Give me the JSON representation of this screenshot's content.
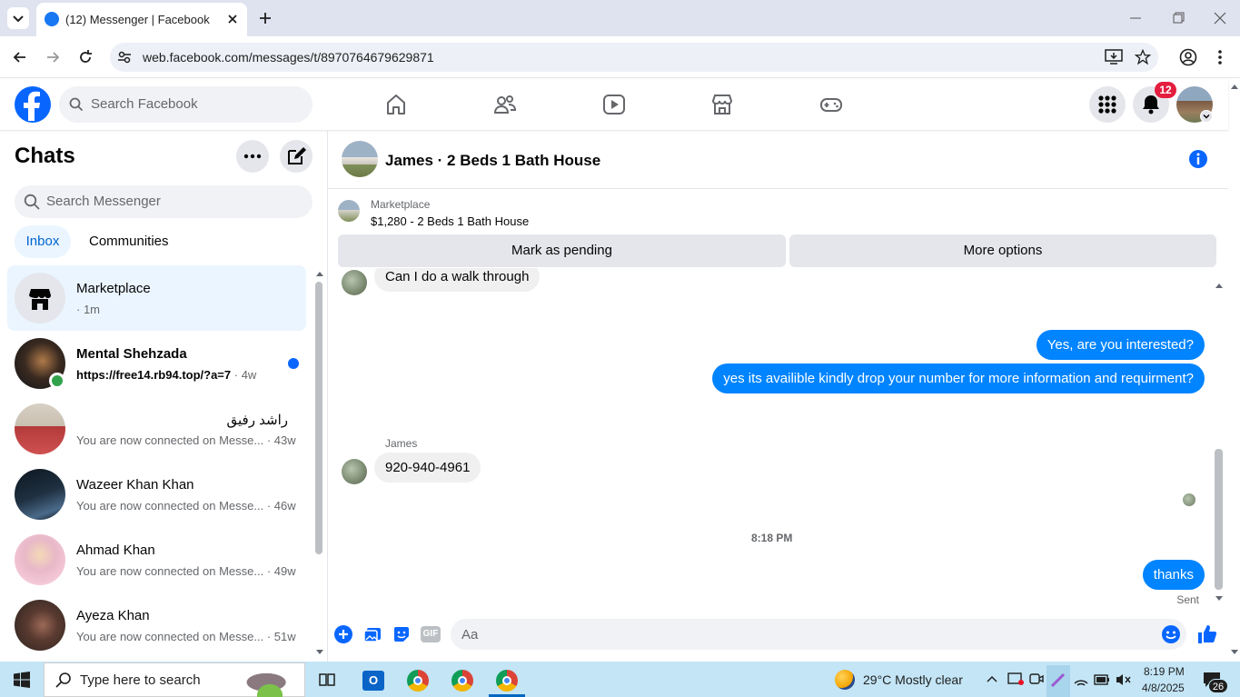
{
  "browser": {
    "tab_title": "(12) Messenger | Facebook",
    "url": "web.facebook.com/messages/t/8970764679629871"
  },
  "fb": {
    "search_placeholder": "Search Facebook",
    "notification_count": "12"
  },
  "sidebar": {
    "title": "Chats",
    "search_placeholder": "Search Messenger",
    "tabs": [
      "Inbox",
      "Communities"
    ],
    "chats": [
      {
        "name": "Marketplace",
        "sub": "· 1m"
      },
      {
        "name": "Mental Shehzada",
        "sub": "https://free14.rb94.top/?a=7",
        "time": " · 4w"
      },
      {
        "name": "راشد رفیق",
        "sub": "You are now connected on Messe... · 43w"
      },
      {
        "name": "Wazeer Khan Khan",
        "sub": "You are now connected on Messe... · 46w"
      },
      {
        "name": "Ahmad Khan",
        "sub": "You are now connected on Messe... · 49w"
      },
      {
        "name": "Ayeza Khan",
        "sub": "You are now connected on Messe... · 51w"
      }
    ]
  },
  "conversation": {
    "title": "James · 2 Beds 1 Bath House",
    "marketplace_label": "Marketplace",
    "listing": "$1,280 - 2 Beds 1 Bath House",
    "btn_pending": "Mark as pending",
    "btn_more": "More options",
    "messages": {
      "partial": "Can I do a walk through",
      "out1": "Yes, are you interested?",
      "out2": "yes its availible kindly drop your number for more information and requirment?",
      "sender": "James",
      "in1": "920-940-4961",
      "timestamp": "8:18 PM",
      "out3": "thanks",
      "status": "Sent"
    },
    "composer_placeholder": "Aa"
  },
  "taskbar": {
    "search_placeholder": "Type here to search",
    "weather": "29°C  Mostly clear",
    "time": "8:19 PM",
    "date": "4/8/2025",
    "notif_count": "26"
  }
}
